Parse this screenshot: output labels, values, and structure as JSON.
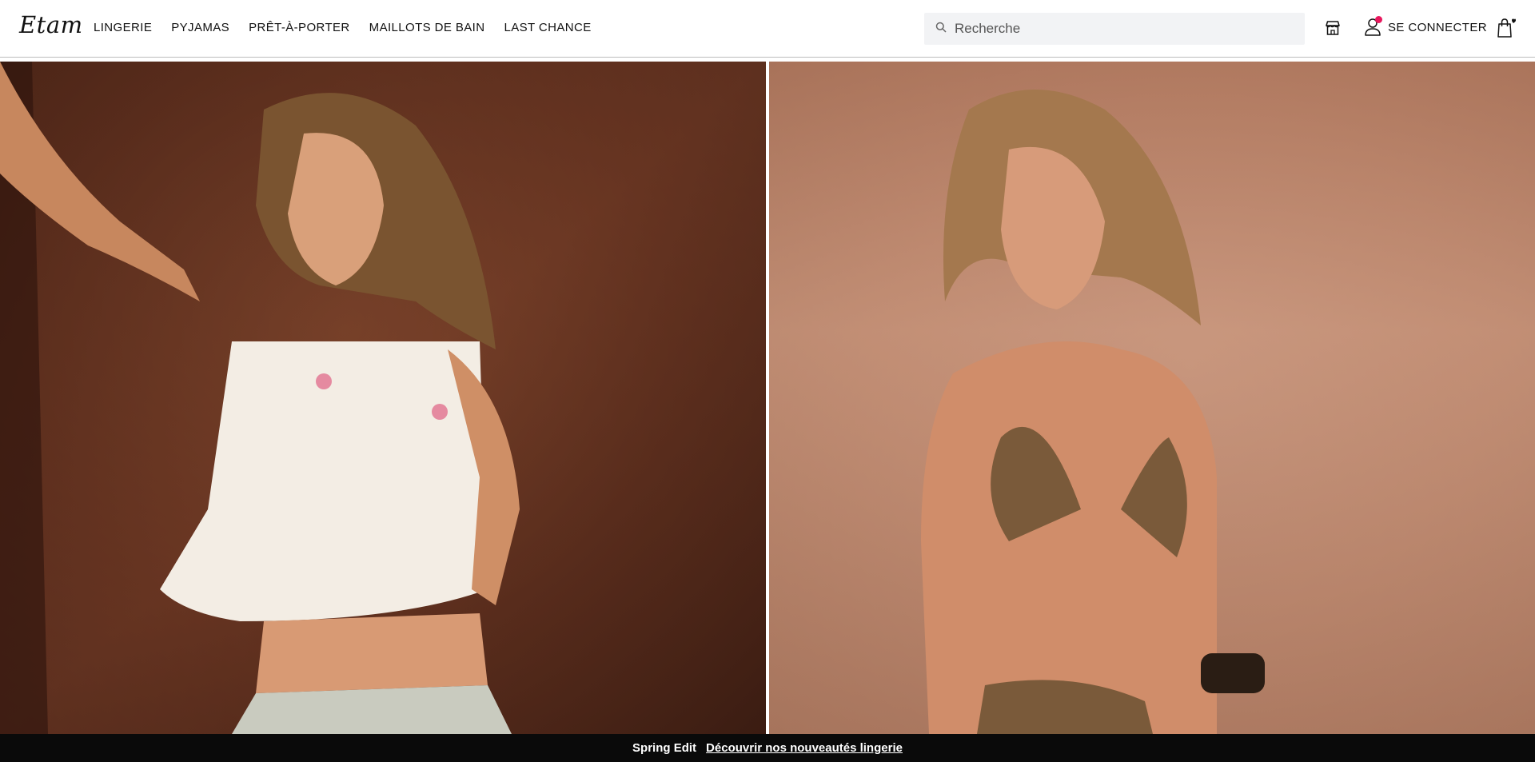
{
  "brand": {
    "logo": "Etam"
  },
  "nav": {
    "items": [
      {
        "label": "LINGERIE"
      },
      {
        "label": "PYJAMAS"
      },
      {
        "label": "PRÊT-À-PORTER"
      },
      {
        "label": "MAILLOTS DE BAIN"
      },
      {
        "label": "LAST CHANCE"
      }
    ]
  },
  "search": {
    "placeholder": "Recherche",
    "value": ""
  },
  "account": {
    "label": "SE CONNECTER",
    "notification": true
  },
  "icons": {
    "store": "store-icon",
    "account": "user-icon",
    "bag": "bag-with-heart-icon",
    "search": "search-icon"
  },
  "hero": {
    "left_image": "model-in-white-embroidered-camisole-and-striped-shorts",
    "right_image": "model-in-leopard-print-bikini-on-beach"
  },
  "promo": {
    "text": "Spring Edit",
    "link": "Découvrir nos nouveautés lingerie"
  },
  "colors": {
    "accent": "#e8175d",
    "promo_bg": "#0a0a0a",
    "search_bg": "#f2f3f5"
  }
}
